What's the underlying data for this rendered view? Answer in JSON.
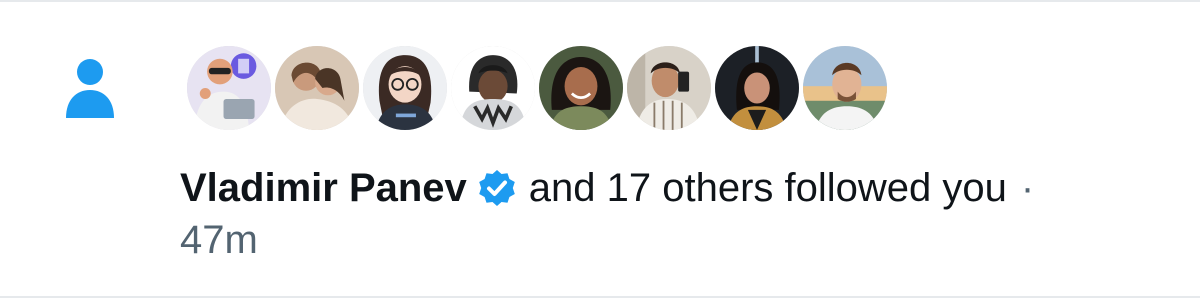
{
  "notification": {
    "icon": "person-icon",
    "accent_color": "#1d9bf0",
    "name": "Vladimir Panev",
    "verified": true,
    "action_text": "and 17 others followed you",
    "separator": "·",
    "time": "47m"
  },
  "avatars": [
    {
      "name": "avatar-1",
      "icon": "cartoon-avatar-icon"
    },
    {
      "name": "avatar-2",
      "icon": "couple-photo-icon"
    },
    {
      "name": "avatar-3",
      "icon": "illustrated-girl-icon"
    },
    {
      "name": "avatar-4",
      "icon": "cartoon-hoodie-icon"
    },
    {
      "name": "avatar-5",
      "icon": "woman-photo-icon"
    },
    {
      "name": "avatar-6",
      "icon": "man-selfie-icon"
    },
    {
      "name": "avatar-7",
      "icon": "woman-portrait-icon"
    },
    {
      "name": "avatar-8",
      "icon": "man-portrait-icon"
    }
  ]
}
